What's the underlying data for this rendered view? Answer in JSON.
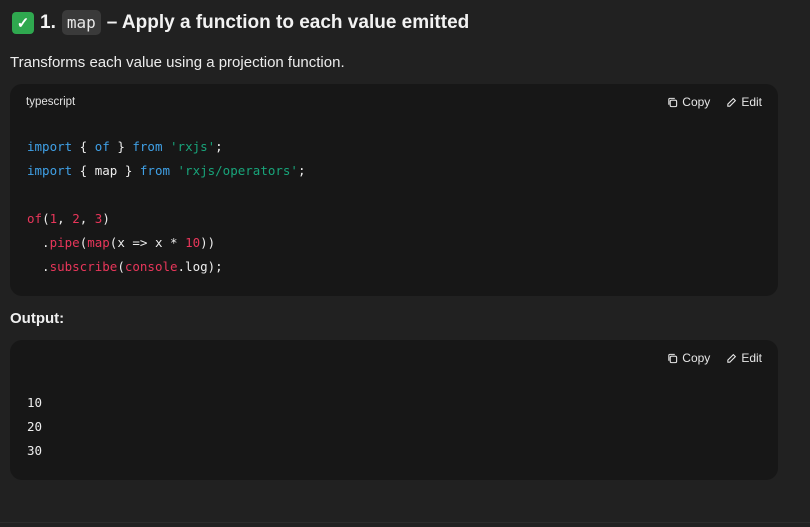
{
  "heading": {
    "check_icon": "check-mark-icon",
    "number": "1.",
    "code": "map",
    "text": "– Apply a function to each value emitted"
  },
  "description": "Transforms each value using a projection function.",
  "code_block": {
    "language": "typescript",
    "copy_label": "Copy",
    "edit_label": "Edit",
    "lines": [
      "import { of } from 'rxjs';",
      "import { map } from 'rxjs/operators';",
      "",
      "of(1, 2, 3)",
      "  .pipe(map(x => x * 10))",
      "  .subscribe(console.log);"
    ]
  },
  "output_label": "Output:",
  "output_block": {
    "copy_label": "Copy",
    "edit_label": "Edit",
    "lines": [
      "10",
      "20",
      "30"
    ]
  },
  "colors": {
    "keyword": "#3fa0e6",
    "string": "#18a47a",
    "function": "#e8365a",
    "number": "#e8365a",
    "check": "#2fa84f"
  }
}
